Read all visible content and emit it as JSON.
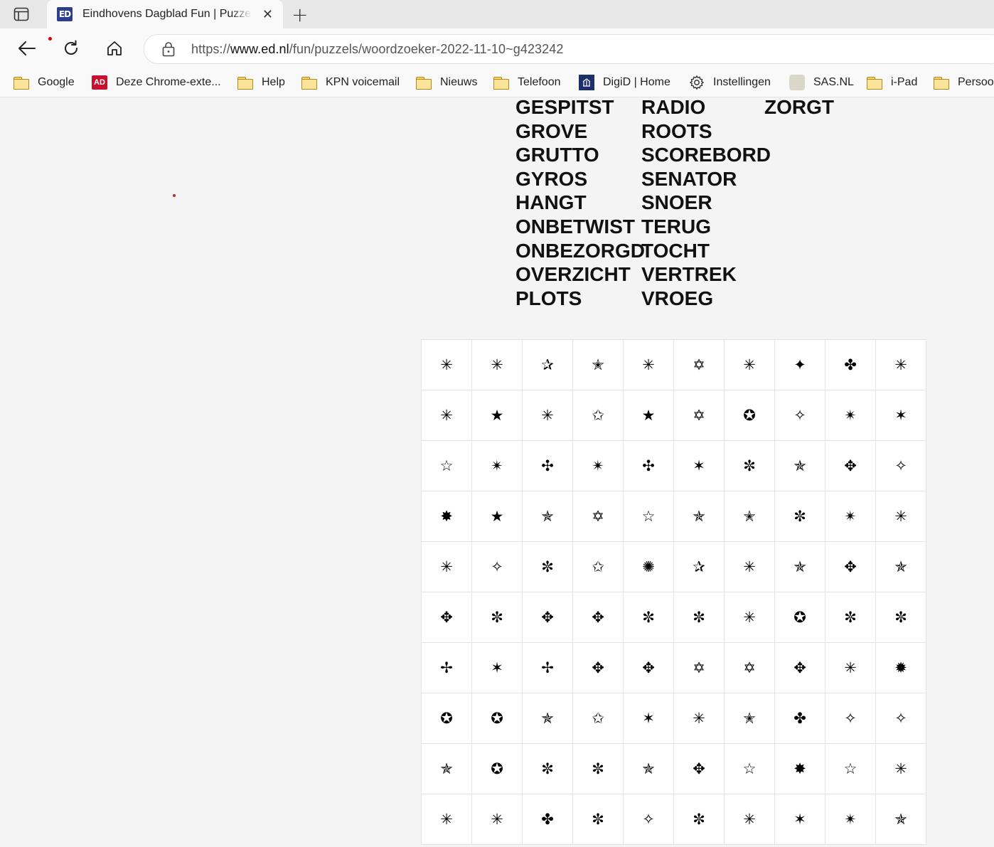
{
  "browser": {
    "tab": {
      "title": "Eindhovens Dagblad Fun | Puzzels",
      "favicon_text": "ED",
      "close_glyph": "✕"
    },
    "new_tab_glyph": "+",
    "address": {
      "url_prefix": "https://",
      "url_domain": "www.ed.nl",
      "url_path": "/fun/puzzels/woordzoeker-2022-11-10~g423242"
    },
    "bookmarks": [
      {
        "label": "Google",
        "icon": "folder-icon"
      },
      {
        "label": "Deze Chrome-exte...",
        "icon": "ad-logo-icon",
        "logo_text": "AD"
      },
      {
        "label": "Help",
        "icon": "folder-icon"
      },
      {
        "label": "KPN voicemail",
        "icon": "folder-icon"
      },
      {
        "label": "Nieuws",
        "icon": "folder-icon"
      },
      {
        "label": "Telefoon",
        "icon": "folder-icon"
      },
      {
        "label": "DigiD | Home",
        "icon": "digid-logo-icon"
      },
      {
        "label": "Instellingen",
        "icon": "gear-icon"
      },
      {
        "label": "SAS.NL",
        "icon": "sas-logo-icon"
      },
      {
        "label": "i-Pad",
        "icon": "folder-icon"
      },
      {
        "label": "Persoonlijk",
        "icon": "folder-icon"
      }
    ]
  },
  "puzzle": {
    "words": [
      [
        "GESPITST",
        "GROVE",
        "GRUTTO",
        "GYROS",
        "HANGT",
        "ONBETWIST",
        "ONBEZORGD",
        "OVERZICHT",
        "PLOTS"
      ],
      [
        "RADIO",
        "ROOTS",
        "SCOREBORD",
        "SENATOR",
        "SNOER",
        "TERUG",
        "TOCHT",
        "VERTREK",
        "VROEG"
      ],
      [
        "ZORGT"
      ]
    ],
    "grid": [
      [
        "✳",
        "✳",
        "✰",
        "✭",
        "✳",
        "✡",
        "✳",
        "✦",
        "✤",
        "✳"
      ],
      [
        "✳",
        "★",
        "✳",
        "✩",
        "★",
        "✡",
        "✪",
        "✧",
        "✴",
        "✶"
      ],
      [
        "☆",
        "✴",
        "✣",
        "✴",
        "✣",
        "✶",
        "✼",
        "✯",
        "✥",
        "✧"
      ],
      [
        "✸",
        "★",
        "✯",
        "✡",
        "☆",
        "✯",
        "✭",
        "✼",
        "✴",
        "✳"
      ],
      [
        "✳",
        "✧",
        "✼",
        "✩",
        "✺",
        "✰",
        "✳",
        "✯",
        "✥",
        "✯"
      ],
      [
        "✥",
        "✼",
        "✥",
        "✥",
        "✼",
        "✼",
        "✳",
        "✪",
        "✼",
        "✼"
      ],
      [
        "✢",
        "✶",
        "✢",
        "✥",
        "✥",
        "✡",
        "✡",
        "✥",
        "✳",
        "✹"
      ],
      [
        "✪",
        "✪",
        "✯",
        "✩",
        "✶",
        "✳",
        "✭",
        "✤",
        "✧",
        "✧"
      ],
      [
        "✯",
        "✪",
        "✼",
        "✼",
        "✯",
        "✥",
        "☆",
        "✸",
        "☆",
        "✳"
      ],
      [
        "✳",
        "✳",
        "✤",
        "✼",
        "✧",
        "✼",
        "✳",
        "✶",
        "✴",
        "✯"
      ]
    ]
  }
}
